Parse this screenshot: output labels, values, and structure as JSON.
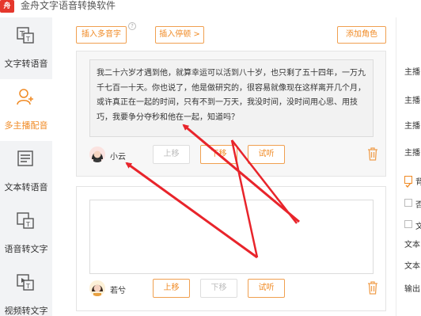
{
  "app": {
    "title": "金舟文字语音转换软件",
    "logo_text": "舟"
  },
  "sidebar": {
    "items": [
      {
        "label": "文字转语音",
        "icon": "text-to-speech-icon"
      },
      {
        "label": "多主播配音",
        "icon": "multi-anchor-icon",
        "active": true
      },
      {
        "label": "文本转语音",
        "icon": "document-to-speech-icon"
      },
      {
        "label": "语音转文字",
        "icon": "speech-to-text-icon"
      },
      {
        "label": "视频转文字",
        "icon": "video-to-text-icon"
      }
    ]
  },
  "toolbar": {
    "insert_polyphone": "插入多音字",
    "insert_pause": "插入停顿 >",
    "add_role": "添加角色",
    "help": "?"
  },
  "cards": [
    {
      "text": "我二十六岁才遇到他，就算幸运可以活到八十岁，也只剩了五十四年，一万九千七百一十天。你也说了，他是做研究的，很容易就像现在这样离开几个月，或许真正在一起的时间，只有不到一万天，我没时间，没时间用心思、用技巧，我要争分夺秒和他在一起，知道吗？",
      "voice": "小云",
      "up": "上移",
      "down": "下移",
      "listen": "试听",
      "up_disabled": true,
      "down_disabled": false
    },
    {
      "text": "",
      "voice": "若兮",
      "up": "上移",
      "down": "下移",
      "listen": "试听",
      "up_disabled": false,
      "down_disabled": true
    }
  ],
  "right_panel": {
    "labels": [
      "主播",
      "主播",
      "主播",
      "主播"
    ],
    "check_labels": [
      "背",
      "否",
      "文"
    ],
    "misc": [
      "文本",
      "文本",
      "输出"
    ]
  },
  "colors": {
    "accent": "#f08a24",
    "arrow": "#e8242b",
    "sidebar_bg": "#f2f3f5"
  }
}
